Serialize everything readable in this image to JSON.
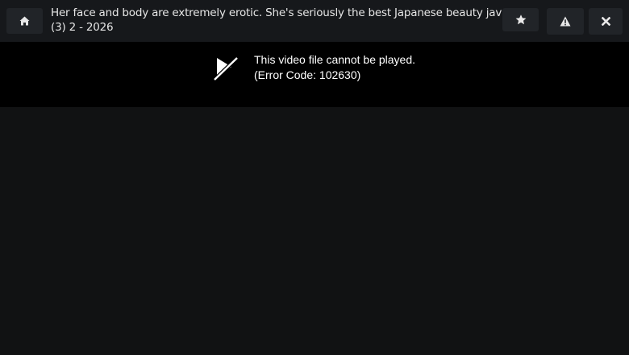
{
  "header": {
    "title": "Her face and body are extremely erotic. She's seriously the best Japanese beauty jav (3) 2 - 2026",
    "buttons": {
      "home_icon": "home-icon",
      "favorite_icon": "star-icon",
      "report_icon": "warning-icon",
      "close_icon": "close-icon"
    }
  },
  "player": {
    "error_icon": "video-unavailable-icon",
    "error_message": "This video file cannot be played.",
    "error_code": "(Error Code: 102630)"
  },
  "colors": {
    "topbar_bg": "#16181b",
    "button_bg": "#212428",
    "player_bg": "#000000",
    "page_bg": "#111213",
    "text": "#e6e6e6"
  }
}
